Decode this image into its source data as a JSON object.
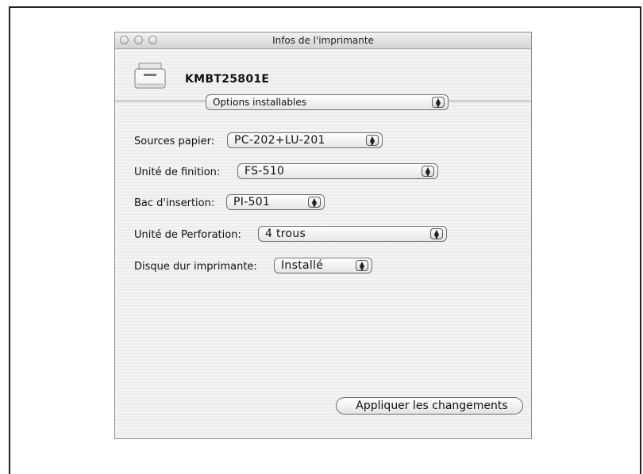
{
  "window": {
    "title": "Infos de l'imprimante"
  },
  "printer": {
    "name": "KMBT25801E",
    "icon": "printer-icon"
  },
  "tab_popup": {
    "selected": "Options installables"
  },
  "options": [
    {
      "label": "Sources papier:",
      "value": "PC-202+LU-201"
    },
    {
      "label": "Unité de finition:",
      "value": "FS-510"
    },
    {
      "label": "Bac d'insertion:",
      "value": "PI-501"
    },
    {
      "label": "Unité de Perforation:",
      "value": "4 trous"
    },
    {
      "label": "Disque dur imprimante:",
      "value": "Installé"
    }
  ],
  "apply_button": {
    "label": "Appliquer les changements"
  }
}
